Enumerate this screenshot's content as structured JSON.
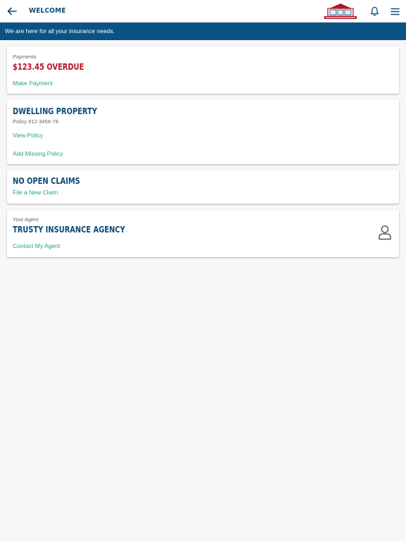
{
  "header": {
    "title": "WELCOME",
    "back_icon": "arrow-left-icon",
    "notifications_icon": "bell-icon",
    "menu_icon": "hamburger-menu-icon",
    "logo_icon": "insurance-agency-logo",
    "accent_color": "#0c4a76"
  },
  "banner": {
    "message": "We are here for all your insurance needs.",
    "background": "#0c5385"
  },
  "payments": {
    "label": "Payments",
    "amount_status": "$123.45 OVERDUE",
    "status_color": "#b0182a",
    "action": "Make Payment"
  },
  "policy": {
    "title": "DWELLING PROPERTY",
    "number": "Policy #12-3456-78",
    "view_action": "View Policy",
    "add_action": "Add Missing Policy"
  },
  "claims": {
    "title": "NO OPEN CLAIMS",
    "action": "File a New Claim"
  },
  "agent": {
    "label": "Your Agent",
    "name": "TRUSTY INSURANCE AGENCY",
    "action": "Contact My Agent",
    "icon": "person-icon"
  },
  "link_color": "#2a9d8f"
}
